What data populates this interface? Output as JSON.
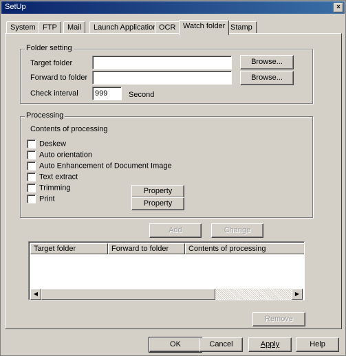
{
  "window": {
    "title": "SetUp",
    "close_glyph": "×"
  },
  "tabs": [
    {
      "label": "System"
    },
    {
      "label": "FTP"
    },
    {
      "label": "Mail"
    },
    {
      "label": "Launch Application"
    },
    {
      "label": "OCR"
    },
    {
      "label": "Watch folder"
    },
    {
      "label": "Stamp"
    }
  ],
  "active_tab": "Watch folder",
  "folder_setting": {
    "title": "Folder setting",
    "target_label": "Target folder",
    "target_value": "",
    "forward_label": "Forward to folder",
    "forward_value": "",
    "interval_label": "Check interval",
    "interval_value": "999",
    "interval_unit": "Second",
    "browse_label": "Browse..."
  },
  "processing": {
    "title": "Processing",
    "contents_label": "Contents of processing",
    "options": [
      {
        "label": "Deskew",
        "checked": false
      },
      {
        "label": "Auto orientation",
        "checked": false
      },
      {
        "label": "Auto Enhancement of Document Image",
        "checked": false
      },
      {
        "label": "Text extract",
        "checked": false
      },
      {
        "label": "Trimming",
        "checked": false
      },
      {
        "label": "Print",
        "checked": false
      }
    ],
    "property_label": "Property"
  },
  "actions": {
    "add": "Add",
    "change": "Change",
    "remove": "Remove"
  },
  "list": {
    "columns": [
      "Target folder",
      "Forward to folder",
      "Contents of processing"
    ],
    "rows": []
  },
  "scrollbar": {
    "left_glyph": "◀",
    "right_glyph": "▶"
  },
  "footer": {
    "ok": "OK",
    "cancel": "Cancel",
    "apply": "Apply",
    "help": "Help"
  },
  "colors": {
    "face": "#d4d0c8",
    "title_start": "#0a246a",
    "title_end": "#3a6ea5"
  }
}
